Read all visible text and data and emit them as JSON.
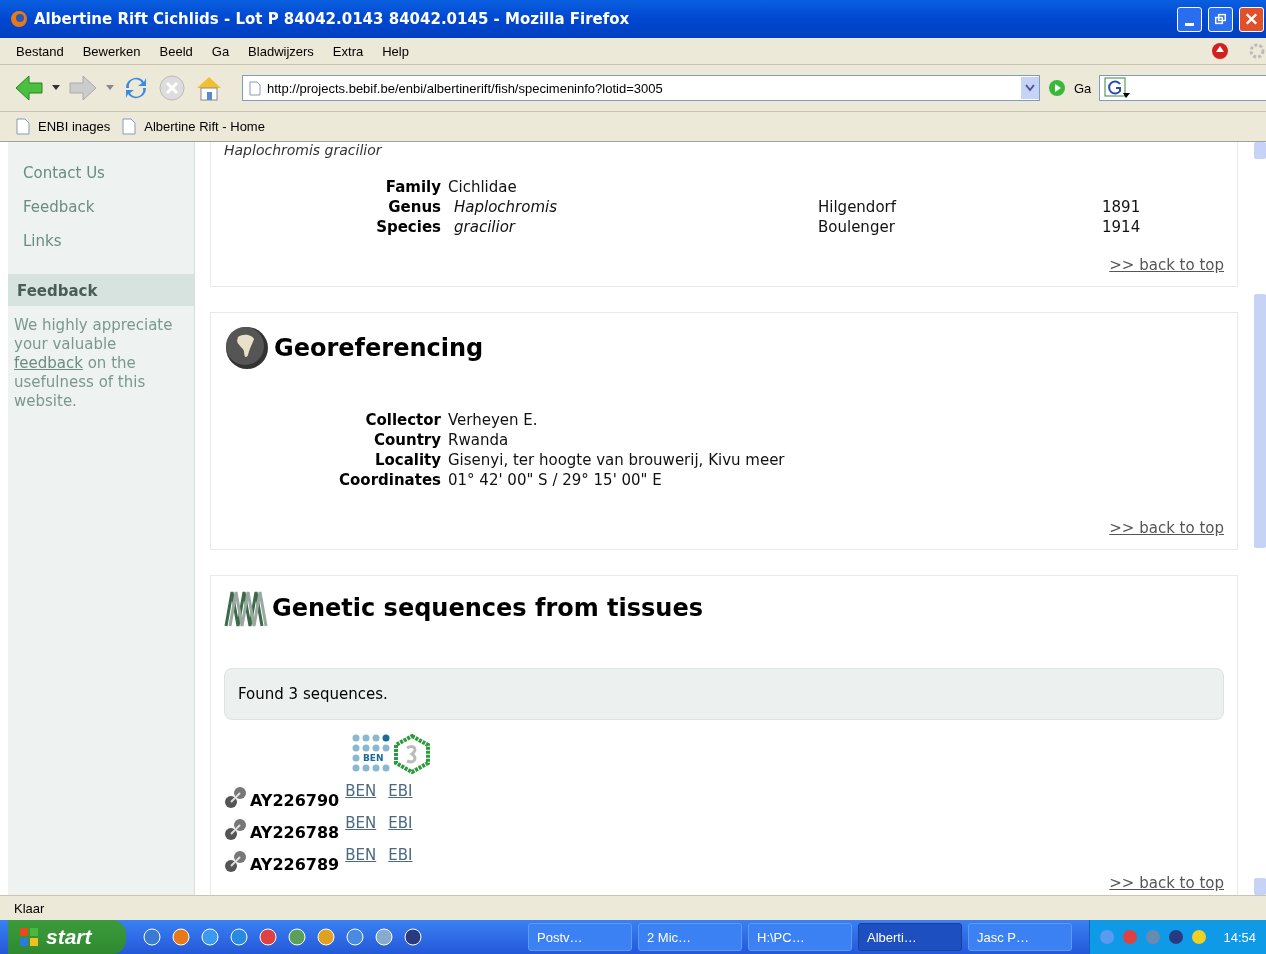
{
  "window": {
    "title": "Albertine Rift Cichlids - Lot P 84042.0143 84042.0145 - Mozilla Firefox"
  },
  "menu": [
    "Bestand",
    "Bewerken",
    "Beeld",
    "Ga",
    "Bladwijzers",
    "Extra",
    "Help"
  ],
  "toolbar": {
    "url": "http://projects.bebif.be/enbi/albertinerift/fish/specimeninfo?lotid=3005",
    "go_label": "Ga"
  },
  "bookmarks": [
    "ENBI inages",
    "Albertine Rift - Home"
  ],
  "sidebar": {
    "items": [
      "Contact Us",
      "Feedback",
      "Links"
    ],
    "feedback": {
      "heading": "Feedback",
      "before": "We highly appreciate your valuable",
      "link": "feedback",
      "after": "on the usefulness of this website."
    }
  },
  "taxonomy": {
    "name": "Haplochromis gracilior",
    "rows": [
      {
        "label": "Family",
        "value": "Cichlidae",
        "italic": false
      },
      {
        "label": "Genus",
        "value": "Haplochromis",
        "italic": true,
        "author": "Hilgendorf",
        "year": "1891"
      },
      {
        "label": "Species",
        "value": "gracilior",
        "italic": true,
        "author": "Boulenger",
        "year": "1914"
      }
    ],
    "back_link": ">> back to top"
  },
  "georeferencing": {
    "title": "Georeferencing",
    "rows": [
      {
        "label": "Collector",
        "value": "Verheyen E."
      },
      {
        "label": "Country",
        "value": "Rwanda"
      },
      {
        "label": "Locality",
        "value": "Gisenyi, ter hoogte van brouwerij, Kivu meer"
      },
      {
        "label": "Coordinates",
        "value": "01° 42' 00\" S / 29° 15' 00\" E"
      }
    ],
    "back_link": ">> back to top"
  },
  "genetics": {
    "title": "Genetic sequences from tissues",
    "found": "Found 3 sequences.",
    "logo_text": "BEN",
    "sequences": [
      {
        "id": "AY226790",
        "links": [
          "BEN",
          "EBI"
        ]
      },
      {
        "id": "AY226788",
        "links": [
          "BEN",
          "EBI"
        ]
      },
      {
        "id": "AY226789",
        "links": [
          "BEN",
          "EBI"
        ]
      }
    ],
    "back_link": ">> back to top"
  },
  "status_bar": {
    "text": "Klaar"
  },
  "taskbar": {
    "start": "start",
    "tasks": [
      {
        "label": "Postv…",
        "selected": false
      },
      {
        "label": "2 Mic…",
        "selected": false
      },
      {
        "label": "H:\\PC…",
        "selected": false
      },
      {
        "label": "Alberti…",
        "selected": true
      },
      {
        "label": "Jasc P…",
        "selected": false
      }
    ],
    "clock": "14:54"
  }
}
